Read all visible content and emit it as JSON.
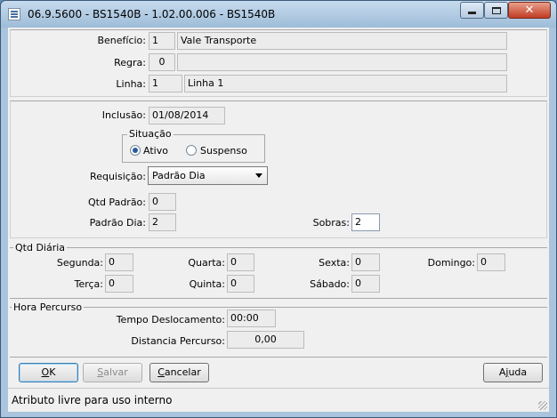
{
  "window": {
    "title": "06.9.5600 - BS1540B - 1.02.00.006 - BS1540B",
    "close_glyph": "✕"
  },
  "header": {
    "beneficio_label": "Benefício:",
    "beneficio_code": "1",
    "beneficio_desc": "Vale Transporte",
    "regra_label": "Regra:",
    "regra_code": "0",
    "regra_desc": "",
    "linha_label": "Linha:",
    "linha_code": "1",
    "linha_desc": "Linha 1"
  },
  "details": {
    "inclusao_label": "Inclusão:",
    "inclusao_value": "01/08/2014",
    "situacao_title": "Situação",
    "ativo_label": "Ativo",
    "suspenso_label": "Suspenso",
    "situacao_selected": "Ativo",
    "requisicao_label": "Requisição:",
    "requisicao_value": "Padrão Dia",
    "qtd_padrao_label": "Qtd Padrão:",
    "qtd_padrao_value": "0",
    "padrao_dia_label": "Padrão Dia:",
    "padrao_dia_value": "2",
    "sobras_label": "Sobras:",
    "sobras_value": "2"
  },
  "qtd_diaria": {
    "title": "Qtd Diária",
    "segunda_label": "Segunda:",
    "segunda_value": "0",
    "terca_label": "Terça:",
    "terca_value": "0",
    "quarta_label": "Quarta:",
    "quarta_value": "0",
    "quinta_label": "Quinta:",
    "quinta_value": "0",
    "sexta_label": "Sexta:",
    "sexta_value": "0",
    "sabado_label": "Sábado:",
    "sabado_value": "0",
    "domingo_label": "Domingo:",
    "domingo_value": "0"
  },
  "hora_percurso": {
    "title": "Hora Percurso",
    "tempo_label": "Tempo Deslocamento:",
    "tempo_value": "00:00",
    "distancia_label": "Distancia  Percurso:",
    "distancia_value": "0,00"
  },
  "buttons": {
    "ok_mnemonic": "O",
    "ok_rest": "K",
    "salvar_mnemonic": "S",
    "salvar_rest": "alvar",
    "cancelar_mnemonic": "C",
    "cancelar_rest": "ancelar",
    "ajuda_first": "A",
    "ajuda_mnemonic": "j",
    "ajuda_rest": "uda"
  },
  "status": {
    "text": "Atributo livre para uso interno"
  }
}
